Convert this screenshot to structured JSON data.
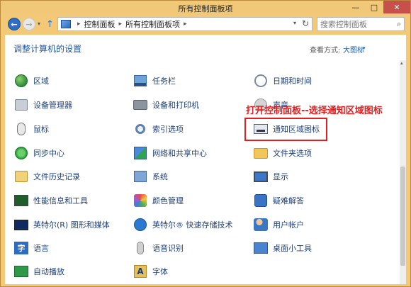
{
  "window": {
    "title": "所有控制面板项",
    "min_label": "—",
    "max_label": "□",
    "close_label": "✕"
  },
  "nav": {
    "back_glyph": "←",
    "forward_glyph": "→",
    "dropdown_glyph": "▾",
    "up_glyph": "↑",
    "breadcrumb": [
      "控制面板",
      "所有控制面板项"
    ],
    "separator": "▸",
    "address_drop_glyph": "▾",
    "refresh_glyph": "↻",
    "search_placeholder": "搜索控制面板",
    "search_glyph": "⌕"
  },
  "content": {
    "page_title": "调整计算机的设置",
    "view_label": "查看方式:",
    "view_value": "大图标",
    "view_drop_glyph": "▾",
    "scroll_up_glyph": "▴"
  },
  "items": {
    "region": {
      "label": "区域",
      "icon": "globe-icon"
    },
    "taskbar": {
      "label": "任务栏",
      "icon": "taskbar-icon"
    },
    "datetime": {
      "label": "日期和时间",
      "icon": "clock-icon"
    },
    "device_manager": {
      "label": "设备管理器",
      "icon": "device-manager-icon"
    },
    "devices_printers": {
      "label": "设备和打印机",
      "icon": "printer-icon"
    },
    "sound": {
      "label": "声音",
      "icon": "speaker-icon"
    },
    "mouse": {
      "label": "鼠标",
      "icon": "mouse-icon"
    },
    "indexing": {
      "label": "索引选项",
      "icon": "indexing-icon"
    },
    "notification": {
      "label": "通知区域图标",
      "icon": "notification-area-icon"
    },
    "sync": {
      "label": "同步中心",
      "icon": "sync-icon"
    },
    "network": {
      "label": "网络和共享中心",
      "icon": "network-icon"
    },
    "folder_options": {
      "label": "文件夹选项",
      "icon": "folder-icon"
    },
    "file_history": {
      "label": "文件历史记录",
      "icon": "file-history-icon"
    },
    "system": {
      "label": "系统",
      "icon": "system-icon"
    },
    "display": {
      "label": "显示",
      "icon": "display-icon"
    },
    "performance": {
      "label": "性能信息和工具",
      "icon": "performance-icon"
    },
    "color": {
      "label": "颜色管理",
      "icon": "color-management-icon"
    },
    "troubleshooting": {
      "label": "疑难解答",
      "icon": "troubleshooting-icon"
    },
    "intel_graphics": {
      "label": "英特尔(R) 图形和媒体",
      "icon": "intel-graphics-icon"
    },
    "intel_rst": {
      "label": "英特尔® 快速存储技术",
      "icon": "intel-rst-icon"
    },
    "user_accounts": {
      "label": "用户帐户",
      "icon": "user-accounts-icon"
    },
    "language": {
      "label": "语言",
      "icon": "language-icon",
      "glyph": "字"
    },
    "speech": {
      "label": "语音识别",
      "icon": "microphone-icon"
    },
    "gadgets": {
      "label": "桌面小工具",
      "icon": "gadgets-icon"
    },
    "autoplay": {
      "label": "自动播放",
      "icon": "autoplay-icon"
    },
    "fonts": {
      "label": "字体",
      "icon": "font-icon",
      "glyph": "A"
    }
  },
  "annotation": {
    "text": "打开控制面板--选择通知区域图标",
    "color": "#e02020"
  },
  "colors": {
    "link": "#1e3f78",
    "title_blue": "#1e5ba8",
    "window_frame": "#f3c978",
    "close": "#c7504b"
  }
}
